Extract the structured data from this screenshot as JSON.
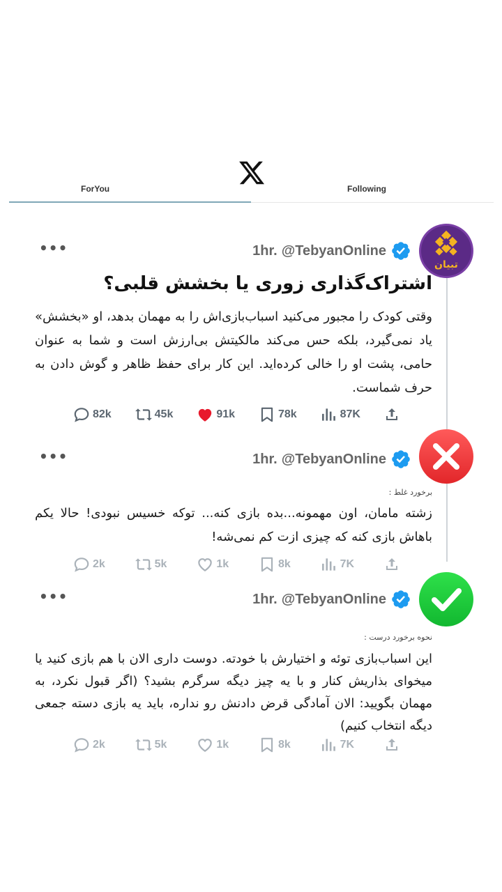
{
  "header": {
    "logo_icon": "x-logo-icon",
    "tabs": [
      {
        "label": "ForYou",
        "active": true
      },
      {
        "label": "Following",
        "active": false
      }
    ]
  },
  "posts": [
    {
      "author_logo_text": "تبیان",
      "time": "1hr.",
      "handle": "@TebyanOnline",
      "title": "اشتراک‌گذاری زوری یا بخشش قلبی؟",
      "body": "وقتی کودک را مجبور می‌کنید اسباب‌بازی‌اش را به مهمان بدهد، او «بخشش» یاد نمی‌گیرد، بلکه حس می‌کند مالکیتش بی‌ارزش است و شما به عنوان حامی، پشت او را خالی کرده‌اید. این کار برای حفظ ظاهر و گوش دادن به حرف شماست.",
      "stats": {
        "replies": "82k",
        "reposts": "45k",
        "likes": "91k",
        "bookmarks": "78k",
        "views": "87K"
      },
      "liked": true
    },
    {
      "avatar_icon": "x-mark-icon",
      "time": "1hr.",
      "handle": "@TebyanOnline",
      "label": "برخورد غلط :",
      "body": "زشته مامان، اون مهمونه...بده بازی کنه... توکه خسیس نبودی! حالا یکم باهاش بازی کنه که چیزی ازت کم نمی‌شه!",
      "stats": {
        "replies": "2k",
        "reposts": "5k",
        "likes": "1k",
        "bookmarks": "8k",
        "views": "7K"
      },
      "liked": false
    },
    {
      "avatar_icon": "check-mark-icon",
      "time": "1hr.",
      "handle": "@TebyanOnline",
      "label": "نحوه برخورد درست :",
      "body": "این اسباب‌بازی توئه و اختیارش با خودته. دوست داری الان با هم بازی کنید یا میخوای بذاریش کنار و با یه چیز دیگه سرگرم بشید؟ (اگر قبول نکرد، به مهمان بگویید: الان آمادگی قرض دادنش رو نداره، باید یه بازی دسته جمعی دیگه انتخاب کنیم)",
      "stats": {
        "replies": "2k",
        "reposts": "5k",
        "likes": "1k",
        "bookmarks": "8k",
        "views": "7K"
      },
      "liked": false
    }
  ],
  "colors": {
    "verified": "#1d9bf0",
    "like": "#f91880",
    "wrong": "#e2262a",
    "right": "#12b830",
    "brand_purple": "#5b2a86",
    "brand_gold": "#f4b321"
  }
}
